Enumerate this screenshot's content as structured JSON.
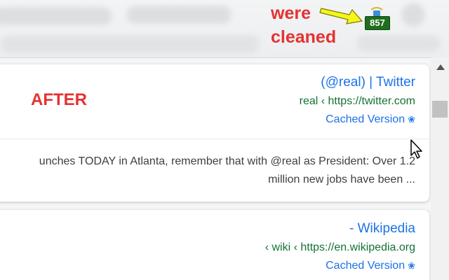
{
  "annotation": {
    "line1": "were",
    "line2": "cleaned",
    "after": "AFTER"
  },
  "extension_badge": {
    "count": "857",
    "icon": "bucket-icon"
  },
  "results": [
    {
      "title": "(@real) | Twitter",
      "url": "real ‹ https://twitter.com",
      "cached": "Cached Version",
      "snippet_line1": "unches TODAY in Atlanta, remember that with @real as President: Over 1.2",
      "snippet_line2": "million new jobs have been ..."
    },
    {
      "title": "- Wikipedia",
      "url": "‹ wiki ‹ https://en.wikipedia.org",
      "cached": "Cached Version"
    }
  ],
  "colors": {
    "annotation": "#e53232",
    "link": "#1a73e8",
    "url": "#137333",
    "badge": "#1f6e1f"
  }
}
